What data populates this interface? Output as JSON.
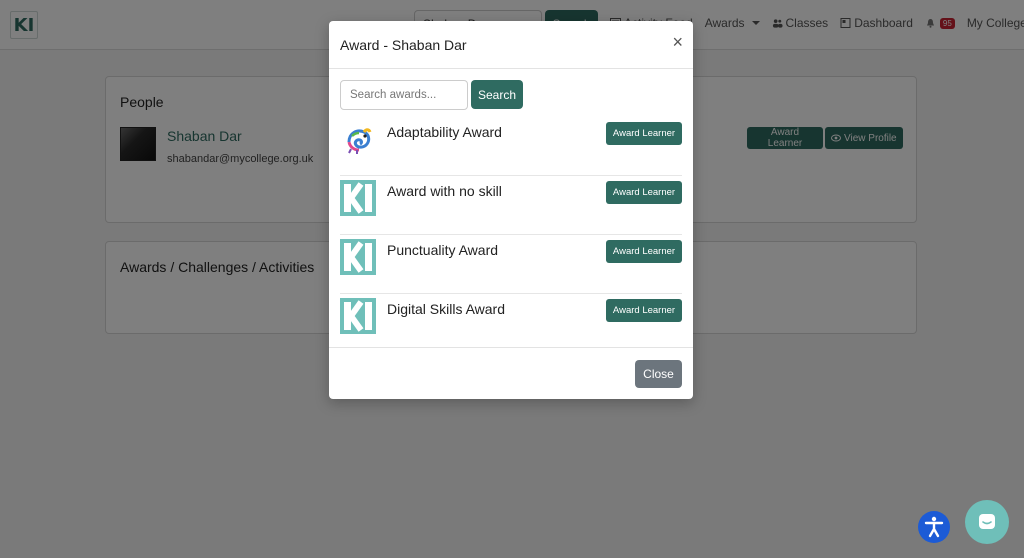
{
  "nav": {
    "logo": "KI",
    "search_value": "Shaban Dar",
    "search_button": "Search",
    "activity_feed": "Activity Feed",
    "awards": "Awards",
    "classes": "Classes",
    "dashboard": "Dashboard",
    "notifications_count": "95",
    "college": "My College"
  },
  "people": {
    "title": "People",
    "person": {
      "name": "Shaban Dar",
      "email": "shabandar@mycollege.org.uk"
    },
    "award_button": "Award Learner",
    "view_profile_button": "View Profile"
  },
  "awards_section": {
    "title": "Awards / Challenges / Activities"
  },
  "modal": {
    "title": "Award - Shaban Dar",
    "close_x": "×",
    "search_placeholder": "Search awards...",
    "search_button": "Search",
    "awards": [
      {
        "name": "Adaptability Award",
        "icon": "chameleon-icon",
        "button": "Award Learner"
      },
      {
        "name": "Award with no skill",
        "icon": "ki-logo-icon",
        "button": "Award Learner"
      },
      {
        "name": "Punctuality Award",
        "icon": "ki-logo-icon",
        "button": "Award Learner"
      },
      {
        "name": "Digital Skills Award",
        "icon": "ki-logo-icon",
        "button": "Award Learner"
      }
    ],
    "close_button": "Close"
  },
  "colors": {
    "brand": "#2f6b61",
    "ki_tile": "#6fbfb9",
    "close_button": "#6c757d",
    "accessibility": "#1c5bd6",
    "badge": "#c82333"
  }
}
